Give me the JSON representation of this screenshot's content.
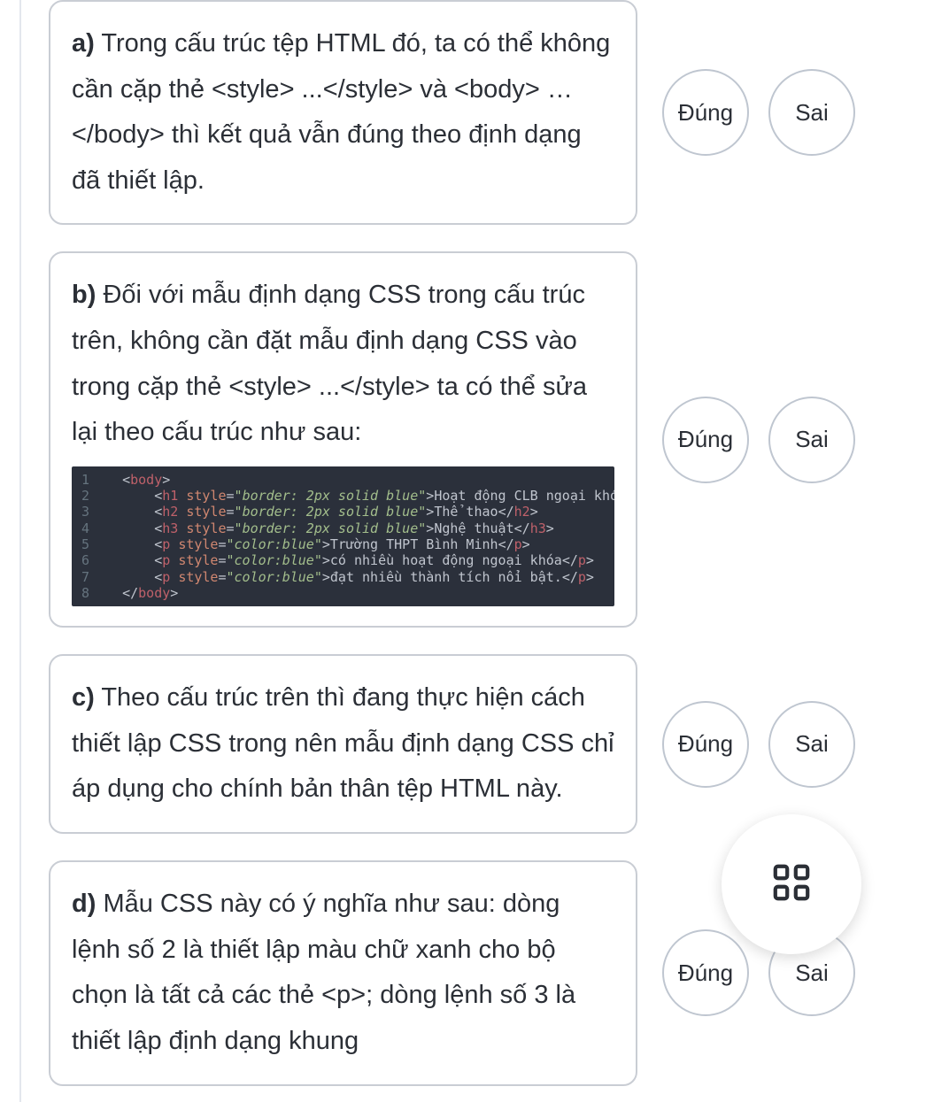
{
  "buttons": {
    "true_label": "Đúng",
    "false_label": "Sai"
  },
  "questions": {
    "a": {
      "label": "a)",
      "text": "Trong cấu trúc tệp HTML đó, ta có thể không cần cặp thẻ <style> ...</style> và <body> … </body> thì kết quả vẫn đúng theo định dạng đã thiết lập."
    },
    "b": {
      "label": "b)",
      "text": "Đối với mẫu định dạng CSS trong cấu trúc trên, không cần đặt mẫu định dạng CSS vào trong cặp thẻ <style> ...</style> ta có thể sửa lại theo cấu trúc như sau:"
    },
    "c": {
      "label": "c)",
      "text": "Theo cấu trúc trên thì đang thực hiện cách thiết lập CSS trong nên mẫu định dạng CSS chỉ áp dụng cho chính bản thân tệp HTML này."
    },
    "d": {
      "label": "d)",
      "text": "Mẫu CSS này có ý nghĩa như sau: dòng lệnh số 2 là thiết lập màu chữ xanh cho bộ chọn là tất cả các thẻ <p>; dòng lệnh số 3 là thiết lập định dạng khung"
    }
  },
  "code": {
    "lines": [
      {
        "n": "1",
        "ind": "   ",
        "open": "<body>",
        "rest": ""
      },
      {
        "n": "2",
        "ind": "       ",
        "tag": "h1",
        "attr": "style",
        "val_ital": "border: 2px solid blue",
        "txt": "Hoạt động CLB ngoại khóa"
      },
      {
        "n": "3",
        "ind": "       ",
        "tag": "h2",
        "attr": "style",
        "val_ital": "border: 2px solid blue",
        "txt": "Thể thao"
      },
      {
        "n": "4",
        "ind": "       ",
        "tag": "h3",
        "attr": "style",
        "val_ital": "border: 2px solid blue",
        "txt": "Nghệ thuật"
      },
      {
        "n": "5",
        "ind": "       ",
        "tag": "p",
        "attr": "style",
        "val_ital": "color:blue",
        "txt": "Trường THPT Bình Minh"
      },
      {
        "n": "6",
        "ind": "       ",
        "tag": "p",
        "attr": "style",
        "val_ital": "color:blue",
        "txt": "có nhiều hoạt động ngoại khóa"
      },
      {
        "n": "7",
        "ind": "       ",
        "tag": "p",
        "attr": "style",
        "val_ital": "color:blue",
        "txt": "đạt nhiều thành tích nổi bật."
      },
      {
        "n": "8",
        "ind": "   ",
        "close": "</body>"
      }
    ]
  }
}
